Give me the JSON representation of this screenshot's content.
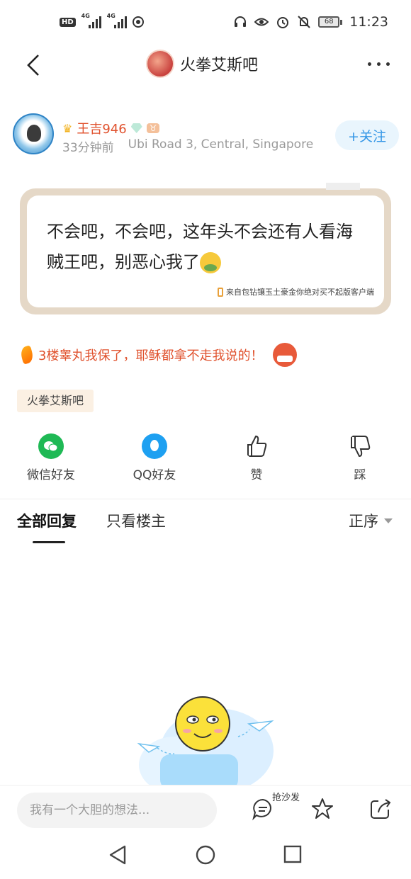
{
  "status_bar": {
    "hd": "HD",
    "net1": "4G",
    "net2": "4G",
    "battery": "68",
    "time": "11:23"
  },
  "header": {
    "title": "火拳艾斯吧"
  },
  "author": {
    "name": "王吉946",
    "zodiac": "♉",
    "time": "33分钟前",
    "location": "Ubi Road 3, Central, Singapore",
    "follow_label": "+关注"
  },
  "post": {
    "text": "不会吧，不会吧，这年头不会还有人看海贼王吧，别恶心我了",
    "device": "来自包钻镶玉土豪金你绝对买不起版客户端"
  },
  "tagline": "3楼睾丸我保了，耶稣都拿不走我说的！",
  "bar_tag": "火拳艾斯吧",
  "share": {
    "wechat": "微信好友",
    "qq": "QQ好友",
    "like": "赞",
    "dislike": "踩"
  },
  "reply_tabs": {
    "all": "全部回复",
    "op_only": "只看楼主",
    "order": "正序"
  },
  "bottom": {
    "input_placeholder": "我有一个大胆的想法...",
    "sofa_label": "抢沙发"
  }
}
